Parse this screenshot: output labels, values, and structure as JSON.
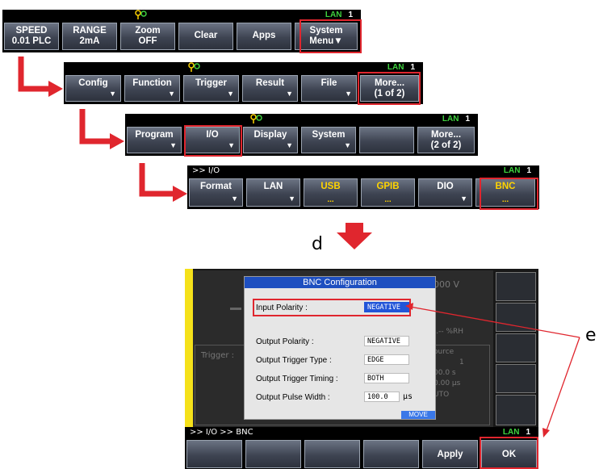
{
  "common": {
    "lan_label": "LAN",
    "lan_count": "1"
  },
  "bar1": {
    "keys": [
      {
        "l1": "SPEED",
        "l2": "0.01 PLC"
      },
      {
        "l1": "RANGE",
        "l2": "2mA"
      },
      {
        "l1": "Zoom",
        "l2": "OFF"
      },
      {
        "mid": "Clear"
      },
      {
        "mid": "Apps"
      },
      {
        "l1": "System",
        "l2": "Menu▼"
      }
    ]
  },
  "bar2": {
    "keys": [
      {
        "label": "Config",
        "arrow": "▼"
      },
      {
        "label": "Function",
        "arrow": "▼"
      },
      {
        "label": "Trigger",
        "arrow": "▼"
      },
      {
        "label": "Result",
        "arrow": "▼"
      },
      {
        "label": "File",
        "arrow": "▼"
      },
      {
        "l1": "More...",
        "l2": "(1 of 2)"
      }
    ]
  },
  "bar3": {
    "keys": [
      {
        "label": "Program",
        "arrow": "▼"
      },
      {
        "label": "I/O",
        "arrow": "▼"
      },
      {
        "label": "Display",
        "arrow": "▼"
      },
      {
        "label": "System",
        "arrow": "▼"
      },
      {
        "label": ""
      },
      {
        "l1": "More...",
        "l2": "(2 of 2)"
      }
    ]
  },
  "bar4": {
    "path": ">> I/O",
    "keys": [
      {
        "label": "Format",
        "arrow": "▼"
      },
      {
        "label": "LAN",
        "arrow": "▼"
      },
      {
        "label": "USB",
        "dots": "..."
      },
      {
        "label": "GPIB",
        "dots": "..."
      },
      {
        "label": "DIO",
        "arrow": "▼"
      },
      {
        "label": "BNC",
        "dots": "..."
      }
    ]
  },
  "step_label_d": "d",
  "step_label_e": "e",
  "screen": {
    "dialog_title": "BNC Configuration",
    "input_polarity_label": "Input Polarity :",
    "input_polarity_value": "NEGATIVE",
    "rows": [
      {
        "label": "Output Polarity :",
        "value": "NEGATIVE"
      },
      {
        "label": "Output Trigger Type :",
        "value": "EDGE"
      },
      {
        "label": "Output Trigger Timing :",
        "value": "BOTH"
      },
      {
        "label": "Output Pulse Width :",
        "value": "100.0"
      }
    ],
    "pulse_unit": "µs",
    "move_label": "MOVE",
    "bg_value1": "000  V",
    "bg_trigger": "Trigger :",
    "bg_rh": "-.-- %RH",
    "bg_source": "ource",
    "bg_1": "1",
    "bg_s": "00.0  s",
    "bg_us": "0.00 µs",
    "bg_uto": "UTO",
    "path": ">> I/O >> BNC",
    "apply_label": "Apply",
    "ok_label": "OK"
  },
  "colors": {
    "highlight": "#e0262e",
    "lan_green": "#3fd23f",
    "dialog_blue": "#1e4fc0",
    "key_yellow": "#ffd400"
  }
}
